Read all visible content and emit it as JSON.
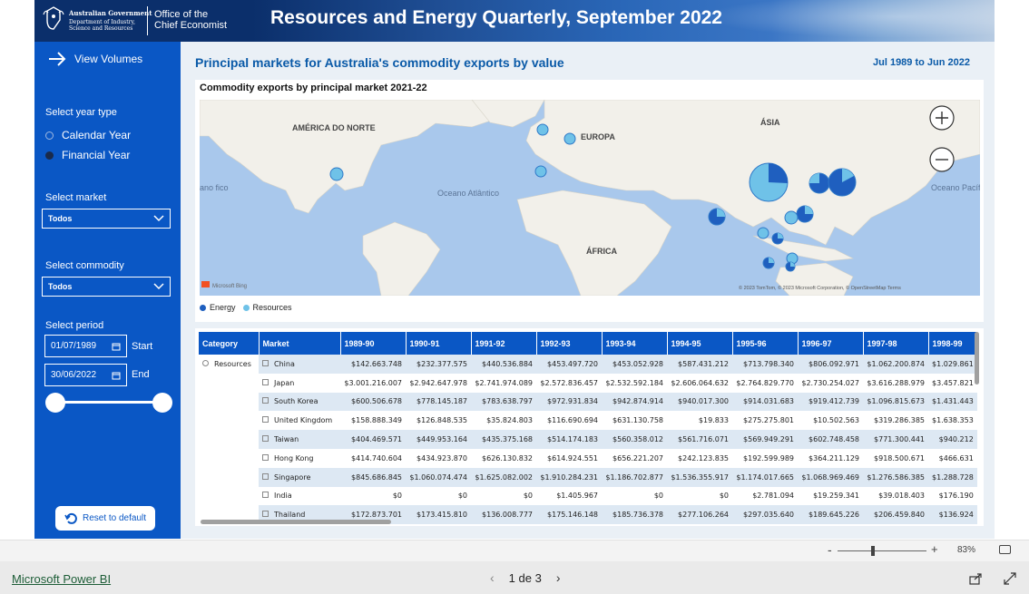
{
  "banner": {
    "gov_line1": "Australian Government",
    "gov_line2": "Department of Industry, Science and Resources",
    "office": [
      "Office of the",
      "Chief Economist"
    ],
    "title": "Resources and Energy Quarterly, September 2022"
  },
  "sidebar": {
    "view_volumes": "View Volumes",
    "year_type_label": "Select year type",
    "year_type_options": [
      "Calendar Year",
      "Financial Year"
    ],
    "year_type_selected": "Financial Year",
    "market_label": "Select market",
    "market_value": "Todos",
    "commodity_label": "Select commodity",
    "commodity_value": "Todos",
    "period_label": "Select period",
    "start_date": "01/07/1989",
    "start_label": "Start",
    "end_date": "30/06/2022",
    "end_label": "End",
    "reset_label": "Reset to default"
  },
  "main": {
    "title": "Principal markets for Australia's commodity exports by value",
    "date_range": "Jul 1989 to Jun 2022",
    "map_title": "Commodity exports by principal market 2021-22",
    "map_labels": {
      "north_america": "AMÉRICA DO NORTE",
      "europe": "EUROPA",
      "asia": "ÁSIA",
      "africa": "ÁFRICA",
      "atlantic": "Oceano Atlântico",
      "pacific": "Oceano Pacífico",
      "pacific_left": "ano fico",
      "bing": "Microsoft Bing",
      "copyright": "© 2023 TomTom, © 2023 Microsoft Corporation, © OpenStreetMap  Terms"
    },
    "legend": [
      {
        "label": "Energy",
        "color": "#1f5fbf"
      },
      {
        "label": "Resources",
        "color": "#6fc2e8"
      }
    ],
    "table": {
      "headers": [
        "Category",
        "Market",
        "1989-90",
        "1990-91",
        "1991-92",
        "1992-93",
        "1993-94",
        "1994-95",
        "1995-96",
        "1996-97",
        "1997-98",
        "1998-99"
      ],
      "category": "Resources",
      "rows": [
        {
          "market": "China",
          "values": [
            "$142.663.748",
            "$232.377.575",
            "$440.536.884",
            "$453.497.720",
            "$453.052.928",
            "$587.431.212",
            "$713.798.340",
            "$806.092.971",
            "$1.062.200.874",
            "$1.029.861"
          ]
        },
        {
          "market": "Japan",
          "values": [
            "$3.001.216.007",
            "$2.942.647.978",
            "$2.741.974.089",
            "$2.572.836.457",
            "$2.532.592.184",
            "$2.606.064.632",
            "$2.764.829.770",
            "$2.730.254.027",
            "$3.616.288.979",
            "$3.457.821"
          ]
        },
        {
          "market": "South Korea",
          "values": [
            "$600.506.678",
            "$778.145.187",
            "$783.638.797",
            "$972.931.834",
            "$942.874.914",
            "$940.017.300",
            "$914.031.683",
            "$919.412.739",
            "$1.096.815.673",
            "$1.431.443"
          ]
        },
        {
          "market": "United Kingdom",
          "values": [
            "$158.888.349",
            "$126.848.535",
            "$35.824.803",
            "$116.690.694",
            "$631.130.758",
            "$19.833",
            "$275.275.801",
            "$10.502.563",
            "$319.286.385",
            "$1.638.353"
          ]
        },
        {
          "market": "Taiwan",
          "values": [
            "$404.469.571",
            "$449.953.164",
            "$435.375.168",
            "$514.174.183",
            "$560.358.012",
            "$561.716.071",
            "$569.949.291",
            "$602.748.458",
            "$771.300.441",
            "$940.212"
          ]
        },
        {
          "market": "Hong Kong",
          "values": [
            "$414.740.604",
            "$434.923.870",
            "$626.130.832",
            "$614.924.551",
            "$656.221.207",
            "$242.123.835",
            "$192.599.989",
            "$364.211.129",
            "$918.500.671",
            "$466.631"
          ]
        },
        {
          "market": "Singapore",
          "values": [
            "$845.686.845",
            "$1.060.074.474",
            "$1.625.082.002",
            "$1.910.284.231",
            "$1.186.702.877",
            "$1.536.355.917",
            "$1.174.017.665",
            "$1.068.969.469",
            "$1.276.586.385",
            "$1.288.728"
          ]
        },
        {
          "market": "India",
          "values": [
            "$0",
            "$0",
            "$0",
            "$1.405.967",
            "$0",
            "$0",
            "$2.781.094",
            "$19.259.341",
            "$39.018.403",
            "$176.190"
          ]
        },
        {
          "market": "Thailand",
          "values": [
            "$172.873.701",
            "$173.415.810",
            "$136.008.777",
            "$175.146.148",
            "$185.736.378",
            "$277.106.264",
            "$297.035.640",
            "$189.645.226",
            "$206.459.840",
            "$136.924"
          ]
        }
      ]
    }
  },
  "zoom": {
    "minus": "-",
    "plus": "+",
    "value": "83%"
  },
  "footer": {
    "brand": "Microsoft Power BI",
    "page": "1 de 3"
  }
}
